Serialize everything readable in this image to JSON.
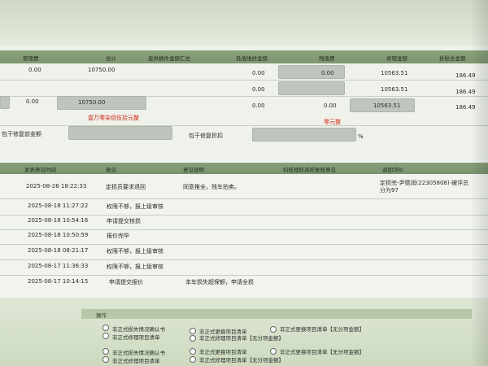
{
  "fee_table": {
    "headers": {
      "mgmt_fee": "管理费",
      "total": "合计",
      "dmg_item_total": "直供换件金额汇总",
      "mat_repair_total": "低值维修金额",
      "residual": "残值费",
      "repair_amount": "修理金额",
      "discount_total": "折损总金额"
    },
    "row1": {
      "mgmt_fee": "0.00",
      "total": "10750.00",
      "mat_repair_total": "0.00",
      "residual": "0.00",
      "repair_amount": "10563.51",
      "discount_total": "186.49"
    },
    "row2": {
      "mat_repair_total": "0.00",
      "repair_amount": "10563.51",
      "discount_total": "186.49"
    },
    "row3": {
      "mgmt_fee": "0.00",
      "total": "10750.00",
      "mat_repair_total": "0.00",
      "residual": "0.00",
      "repair_amount": "10563.51",
      "discount_total": "186.49"
    },
    "amount_in_words_total": "壹万零柒佰伍拾元整",
    "amount_in_words_residual": "零元整",
    "pre_repair_label": "包干修复前金额",
    "repair_discount_label": "包干修复折扣",
    "percent_sign": "%"
  },
  "history": {
    "headers": {
      "time": "发表意见时间",
      "opinion": "意见",
      "remark": "意见说明",
      "review": "科技理赔减损复核意见",
      "feedback": "退回评价"
    },
    "rows": [
      {
        "time": "2025-08-26 18:22:33",
        "opinion": "定损员要求退回",
        "remark": "同意推全，残车拍卖。",
        "feedback": "定损完-尹德润(22305808)-被评总分为97"
      },
      {
        "time": "2025-08-18 11:27:22",
        "opinion": "权限不够，报上级审核"
      },
      {
        "time": "2025-08-18 10:54:16",
        "opinion": "申请提交核损"
      },
      {
        "time": "2025-08-18 10:50:59",
        "opinion": "报价完毕"
      },
      {
        "time": "2025-08-18 08:21:17",
        "opinion": "权限不够，报上级审核"
      },
      {
        "time": "2025-08-17 11:36:33",
        "opinion": "权限不够，报上级审核"
      },
      {
        "time": "2025-08-17 10:14:15",
        "opinion": "申请提交报价",
        "remark": "本车损失超保额，申请全损"
      }
    ]
  },
  "operations": {
    "title": "操作",
    "options": [
      "非正式损失情况确认书",
      "非正式更换项目清单",
      "非正式更换项目清单【无分项金额】",
      "非正式修理项目清单",
      "非正式修理项目清单【无分项金额】",
      "非正式损失情况确认书",
      "非正式更换项目清单",
      "非正式更换项目清单【无分项金额】",
      "非正式修理项目清单",
      "非正式修理项目清单【无分项金额】"
    ]
  }
}
